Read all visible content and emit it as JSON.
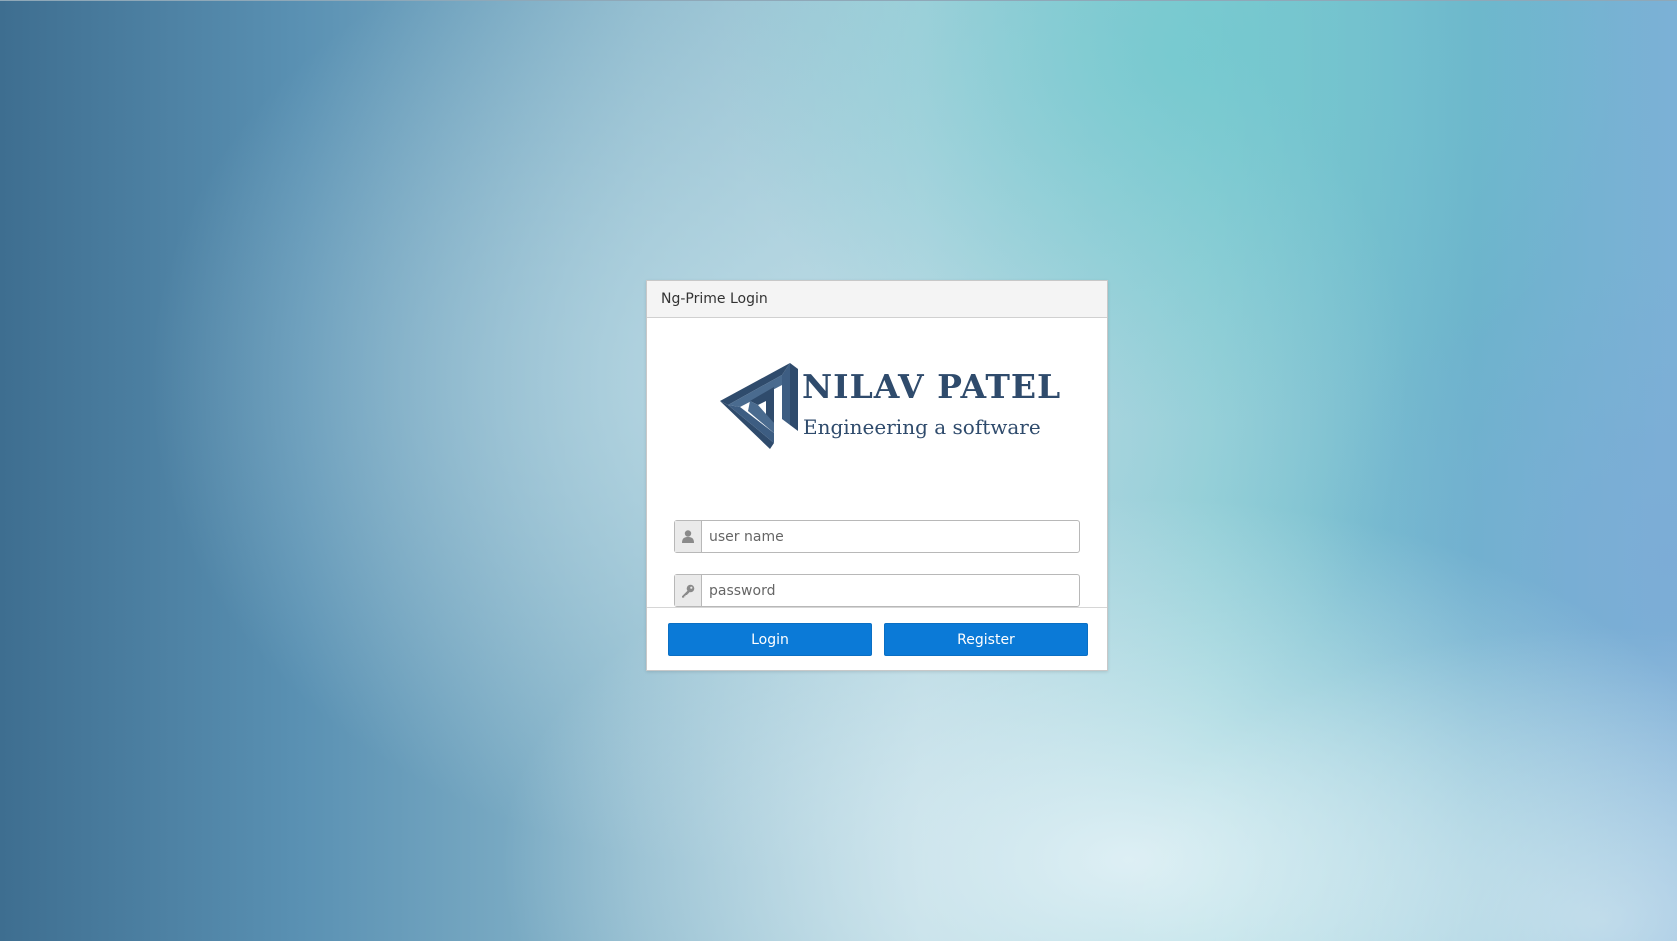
{
  "dialog": {
    "title": "Ng-Prime Login"
  },
  "logo": {
    "title": "NILAV PATEL",
    "subtitle": "Engineering a software",
    "color": "#2f4b6c"
  },
  "form": {
    "username": {
      "placeholder": "user name",
      "value": "",
      "icon": "user-icon"
    },
    "password": {
      "placeholder": "password",
      "value": "",
      "icon": "key-icon"
    }
  },
  "buttons": {
    "login_label": "Login",
    "register_label": "Register",
    "color": "#0b7ad7"
  }
}
